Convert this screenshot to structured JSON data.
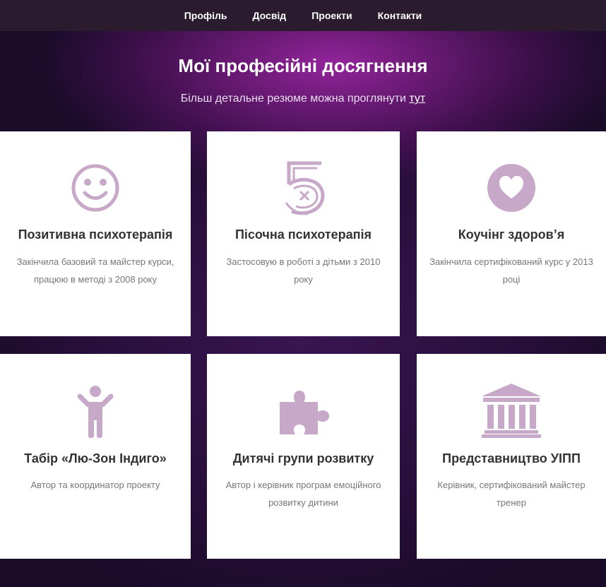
{
  "nav": {
    "items": [
      {
        "label": "Профіль"
      },
      {
        "label": "Досвід"
      },
      {
        "label": "Проекти"
      },
      {
        "label": "Контакти"
      }
    ]
  },
  "hero": {
    "title": "Мої професійні досягнення",
    "subtitle_prefix": "Більш детальне резюме можна проглянути",
    "subtitle_link": "тут"
  },
  "colors": {
    "icon": "#c7a8c8",
    "nav_bg": "#2a1b2f",
    "heading": "#333333",
    "text": "#777777"
  },
  "cards": [
    {
      "icon": "smiley-icon",
      "title": "Позитивна психотерапія",
      "desc": "Закінчила базовий та майстер курси, працюю в методі з 2008 року"
    },
    {
      "icon": "number-five-icon",
      "title": "Пісочна психотерапія",
      "desc": "Застосовую в роботі з дітьми з 2010 року"
    },
    {
      "icon": "heart-icon",
      "title": "Коучінг здоров’я",
      "desc": "Закінчила сертифікований курс у 2013 році"
    },
    {
      "icon": "child-icon",
      "title": "Табір «Лю-Зон Індиго»",
      "desc": "Автор та координатор проекту"
    },
    {
      "icon": "puzzle-icon",
      "title": "Дитячі групи розвитку",
      "desc": "Автор і керівник програм емоційного розвитку дитини"
    },
    {
      "icon": "institution-icon",
      "title": "Представництво УІПП",
      "desc": "Керівник, сертифікований майстер тренер"
    }
  ]
}
